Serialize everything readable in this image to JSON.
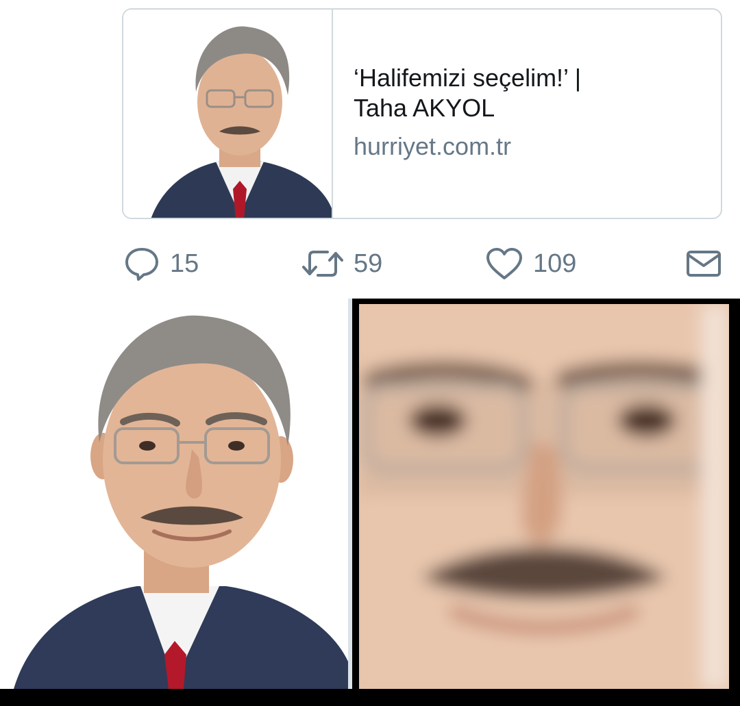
{
  "card": {
    "title_line1": "‘Halifemizi seçelim!’ |",
    "title_line2": "Taha AKYOL",
    "domain": "hurriyet.com.tr"
  },
  "actions": {
    "reply_count": "15",
    "retweet_count": "59",
    "like_count": "109"
  },
  "icons": {
    "reply": "speech-bubble-icon",
    "retweet": "retweet-arrows-icon",
    "like": "heart-icon",
    "dm": "envelope-icon"
  },
  "colors": {
    "text": "#14171a",
    "muted": "#657786",
    "border": "#cfd9de"
  }
}
